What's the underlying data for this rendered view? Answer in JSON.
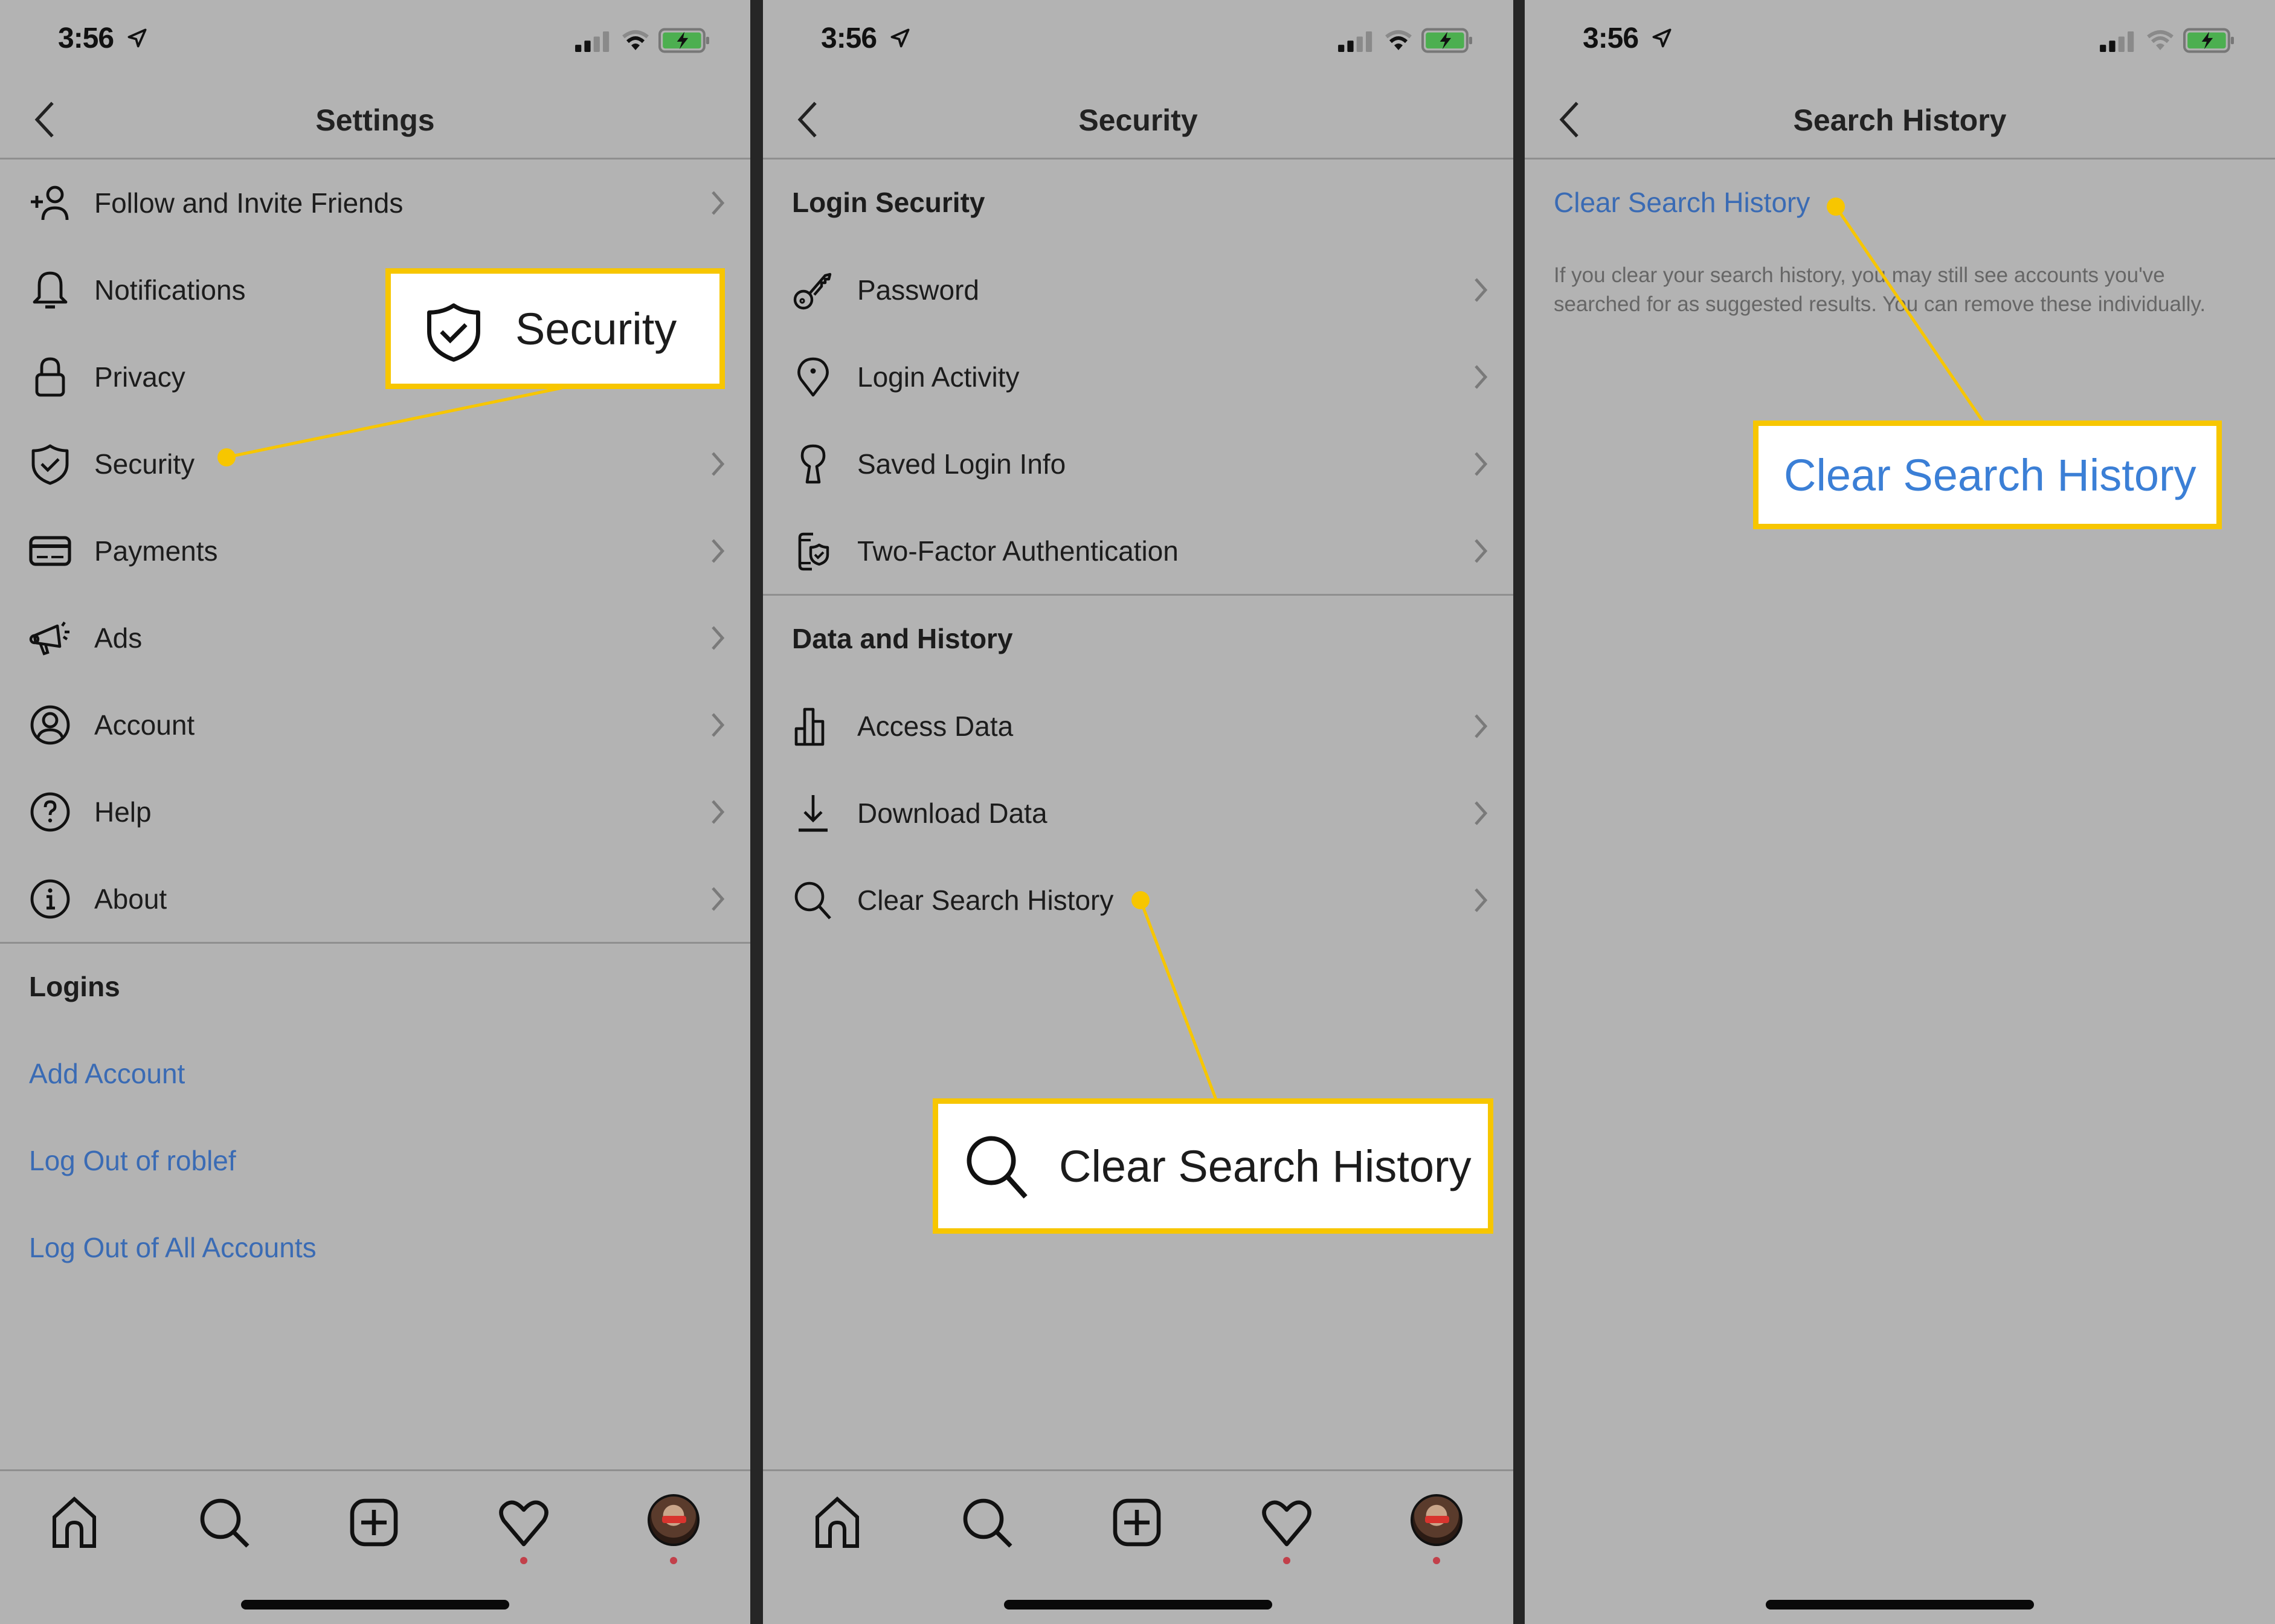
{
  "status_bar": {
    "time": "3:56"
  },
  "panel1": {
    "title": "Settings",
    "items": [
      {
        "label": "Follow and Invite Friends",
        "icon": "add-person-icon"
      },
      {
        "label": "Notifications",
        "icon": "bell-icon"
      },
      {
        "label": "Privacy",
        "icon": "lock-icon"
      },
      {
        "label": "Security",
        "icon": "shield-check-icon"
      },
      {
        "label": "Payments",
        "icon": "credit-card-icon"
      },
      {
        "label": "Ads",
        "icon": "megaphone-icon"
      },
      {
        "label": "Account",
        "icon": "person-circle-icon"
      },
      {
        "label": "Help",
        "icon": "question-circle-icon"
      },
      {
        "label": "About",
        "icon": "info-circle-icon"
      }
    ],
    "logins_header": "Logins",
    "links": [
      "Add Account",
      "Log Out of roblef",
      "Log Out of All Accounts"
    ],
    "callout": {
      "label": "Security",
      "icon": "shield-check-icon"
    }
  },
  "panel2": {
    "title": "Security",
    "section1": "Login Security",
    "section1_items": [
      {
        "label": "Password",
        "icon": "key-icon"
      },
      {
        "label": "Login Activity",
        "icon": "location-pin-icon"
      },
      {
        "label": "Saved Login Info",
        "icon": "keyhole-icon"
      },
      {
        "label": "Two-Factor Authentication",
        "icon": "phone-shield-icon"
      }
    ],
    "section2": "Data and History",
    "section2_items": [
      {
        "label": "Access Data",
        "icon": "bar-chart-icon"
      },
      {
        "label": "Download Data",
        "icon": "download-icon"
      },
      {
        "label": "Clear Search History",
        "icon": "search-icon"
      }
    ],
    "callout": {
      "label": "Clear Search History",
      "icon": "search-icon"
    }
  },
  "panel3": {
    "title": "Search History",
    "link": "Clear Search History",
    "description": "If you clear your search history, you may still see accounts you've searched for as suggested results. You can remove these individually.",
    "callout": {
      "label": "Clear Search History"
    }
  },
  "tab_bar": {
    "tabs": [
      "home",
      "search",
      "new-post",
      "activity",
      "profile"
    ],
    "notification_dots": [
      "activity",
      "profile"
    ]
  },
  "colors": {
    "background": "#b3b3b3",
    "link": "#3a6bb4",
    "callout_border": "#f7c600",
    "badge_dot": "#c2404a",
    "battery": "#4caf50"
  }
}
